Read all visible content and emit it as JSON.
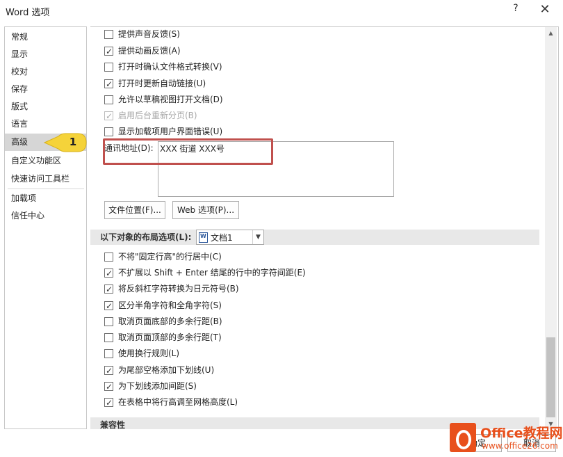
{
  "window": {
    "title": "Word 选项",
    "help": "?",
    "close": "✕"
  },
  "sidebar": {
    "items": [
      {
        "label": "常规"
      },
      {
        "label": "显示"
      },
      {
        "label": "校对"
      },
      {
        "label": "保存"
      },
      {
        "label": "版式"
      },
      {
        "label": "语言"
      },
      {
        "label": "高级",
        "selected": true
      },
      {
        "label": "自定义功能区"
      },
      {
        "label": "快速访问工具栏"
      },
      {
        "label": "加载项"
      },
      {
        "label": "信任中心"
      }
    ],
    "callout_number": "1"
  },
  "general": {
    "options": [
      {
        "label": "提供声音反馈(S)",
        "checked": false
      },
      {
        "label": "提供动画反馈(A)",
        "checked": true
      },
      {
        "label": "打开时确认文件格式转换(V)",
        "checked": false
      },
      {
        "label": "打开时更新自动链接(U)",
        "checked": true
      },
      {
        "label": "允许以草稿视图打开文档(D)",
        "checked": false
      },
      {
        "label": "启用后台重新分页(B)",
        "checked": true,
        "disabled": true
      },
      {
        "label": "显示加载项用户界面错误(U)",
        "checked": false
      }
    ],
    "address_label": "通讯地址(D):",
    "address_value": "XXX 街道 XXX号",
    "file_locations_button": "文件位置(F)...",
    "web_options_button": "Web 选项(P)..."
  },
  "layout": {
    "section_title": "以下对象的布局选项(L):",
    "document_select": "文档1",
    "options": [
      {
        "label": "不将\"固定行高\"的行居中(C)",
        "checked": false
      },
      {
        "label": "不扩展以 Shift + Enter 结尾的行中的字符间距(E)",
        "checked": true
      },
      {
        "label": "将反斜杠字符转换为日元符号(B)",
        "checked": true
      },
      {
        "label": "区分半角字符和全角字符(S)",
        "checked": true
      },
      {
        "label": "取消页面底部的多余行距(B)",
        "checked": false
      },
      {
        "label": "取消页面顶部的多余行距(T)",
        "checked": false
      },
      {
        "label": "使用换行规则(L)",
        "checked": false
      },
      {
        "label": "为尾部空格添加下划线(U)",
        "checked": true
      },
      {
        "label": "为下划线添加间距(S)",
        "checked": true
      },
      {
        "label": "在表格中将行高调至网格高度(L)",
        "checked": true
      }
    ]
  },
  "compat": {
    "section_title": "兼容性"
  },
  "footer": {
    "ok_label": "确定",
    "cancel_label": "取消"
  },
  "watermark": {
    "title": "Office教程网",
    "url": "www.office26.com"
  },
  "colors": {
    "highlight_box": "#c0504d",
    "callout": "#f5d33a",
    "watermark": "#e8501c"
  }
}
